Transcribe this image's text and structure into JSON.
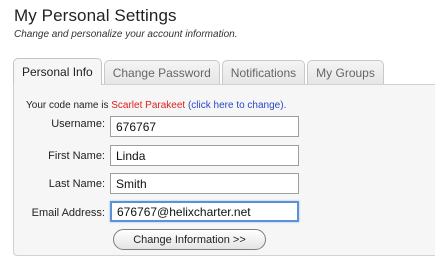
{
  "header": {
    "title": "My Personal Settings",
    "subtitle": "Change and personalize your account information."
  },
  "tabs": [
    {
      "label": "Personal Info",
      "active": true
    },
    {
      "label": "Change Password",
      "active": false
    },
    {
      "label": "Notifications",
      "active": false
    },
    {
      "label": "My Groups",
      "active": false
    }
  ],
  "codename": {
    "prefix": "Your code name is",
    "name": "Scarlet Parakeet",
    "link": "(click here to change)."
  },
  "form": {
    "username": {
      "label": "Username:",
      "value": "676767"
    },
    "first_name": {
      "label": "First Name:",
      "value": "Linda"
    },
    "last_name": {
      "label": "Last Name:",
      "value": "Smith"
    },
    "email": {
      "label": "Email Address:",
      "value": "676767@helixcharter.net"
    },
    "submit_label": "Change Information >>"
  },
  "colors": {
    "codename_red": "#e02020",
    "link_blue": "#2a47c9",
    "focus_blue": "#5c91d6"
  }
}
